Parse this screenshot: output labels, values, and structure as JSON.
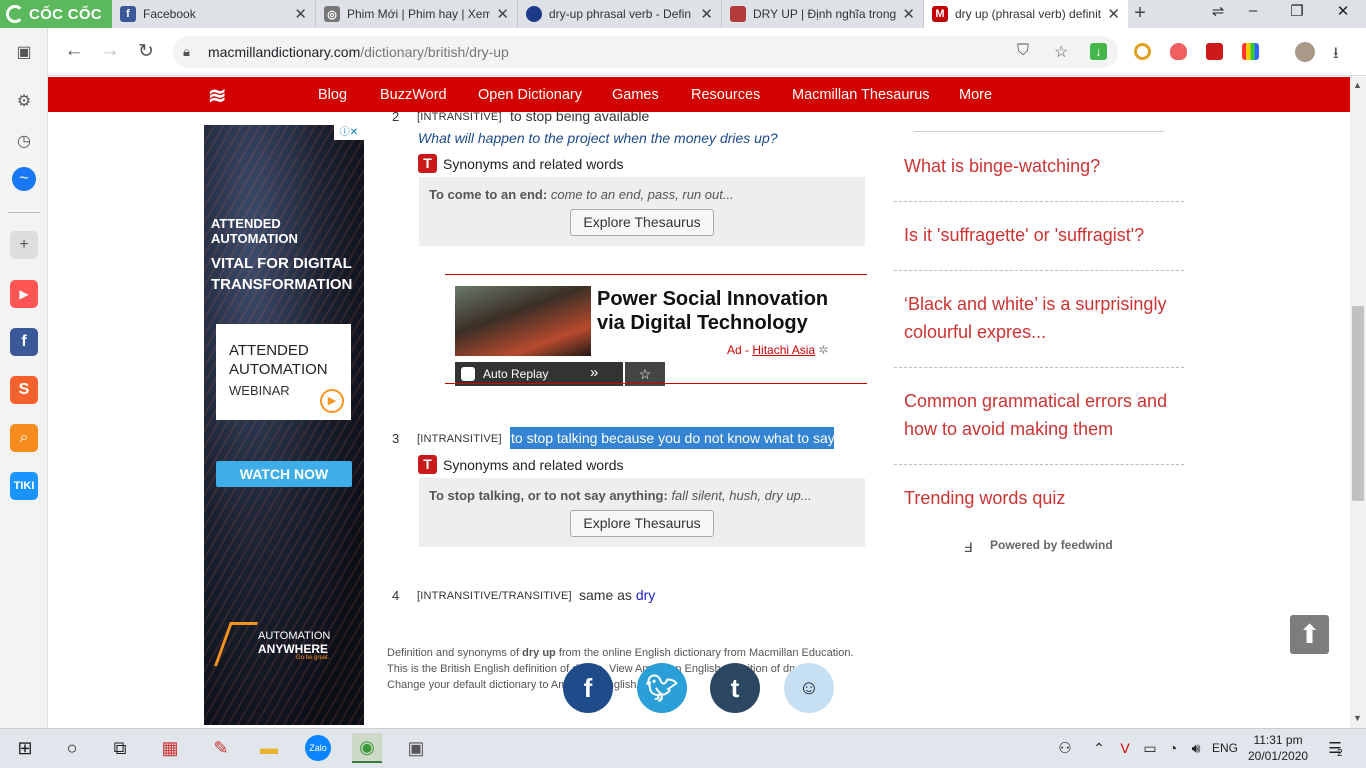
{
  "browser": {
    "brand": "CỐC CỐC",
    "tabs": [
      {
        "title": "Facebook",
        "icon": "facebook-icon",
        "color": "#3b5998"
      },
      {
        "title": "Phim Mới | Phim hay | Xem",
        "icon": "film-icon",
        "color": "#555555"
      },
      {
        "title": "dry-up phrasal verb - Defin",
        "icon": "dictionary-icon",
        "color": "#1d3a8a"
      },
      {
        "title": "DRY UP | Định nghĩa trong",
        "icon": "cambridge-icon",
        "color": "#b33a3a"
      },
      {
        "title": "dry up (phrasal verb) definit",
        "icon": "macmillan-icon",
        "color": "#c00000",
        "active": true
      }
    ],
    "url_host": "macmillandictionary.com",
    "url_path": "/dictionary/british/dry-up"
  },
  "site_nav": {
    "items": [
      "Blog",
      "BuzzWord",
      "Open Dictionary",
      "Games",
      "Resources",
      "Macmillan Thesaurus",
      "More"
    ]
  },
  "ad_left": {
    "headline_small": "ATTENDED AUTOMATION",
    "headline_big": "VITAL FOR DIGITAL TRANSFORMATION",
    "box_line1": "ATTENDED",
    "box_line2": "AUTOMATION",
    "box_line3": "WEBINAR",
    "cta": "WATCH NOW",
    "brand_line1": "AUTOMATION",
    "brand_line2": "ANYWHERE",
    "brand_tag": "Go be great."
  },
  "entries": {
    "sense2": {
      "number": "2",
      "grammar": "[INTRANSITIVE]",
      "definition": "to stop being available",
      "example": "What will happen to the project when the money dries up?",
      "syn_label": "Synonyms and related words",
      "syn_heading": "To come to an end:",
      "syn_words": "come to an end, pass, run out...",
      "explore": "Explore Thesaurus"
    },
    "sense3": {
      "number": "3",
      "grammar": "[INTRANSITIVE]",
      "definition": "to stop talking because you do not know what to say",
      "syn_label": "Synonyms and related words",
      "syn_heading": "To stop talking, or to not say anything:",
      "syn_words": "fall silent, hush, dry up...",
      "explore": "Explore Thesaurus"
    },
    "sense4": {
      "number": "4",
      "grammar": "[INTRANSITIVE/TRANSITIVE]",
      "definition": "same as",
      "link": "dry"
    }
  },
  "video_ad": {
    "title": "Power Social Innovation via Digital Technology",
    "ad_label": "Ad -",
    "sponsor": "Hitachi Asia",
    "auto_replay": "Auto Replay"
  },
  "footer": {
    "line1_pre": "Definition and synonyms of",
    "line1_term": "dry up",
    "line1_post": "from the online English dictionary from Macmillan Education.",
    "line2": "This is the British English definition of dry up. View American English definition of dry up.",
    "line3": "Change your default dictionary to American English."
  },
  "social": [
    "f",
    "t",
    "t",
    "reddit"
  ],
  "right_links": [
    "What is binge-watching?",
    "Is it 'suffragette' or 'suffragist'?",
    "‘Black and white’ is a surprisingly colourful expres...",
    "Common grammatical errors and how to avoid making them",
    "Trending words quiz"
  ],
  "powered_by": "Powered by feedwind",
  "taskbar": {
    "lang": "ENG",
    "time": "11:31 pm",
    "date": "20/01/2020",
    "notif_count": "2"
  }
}
